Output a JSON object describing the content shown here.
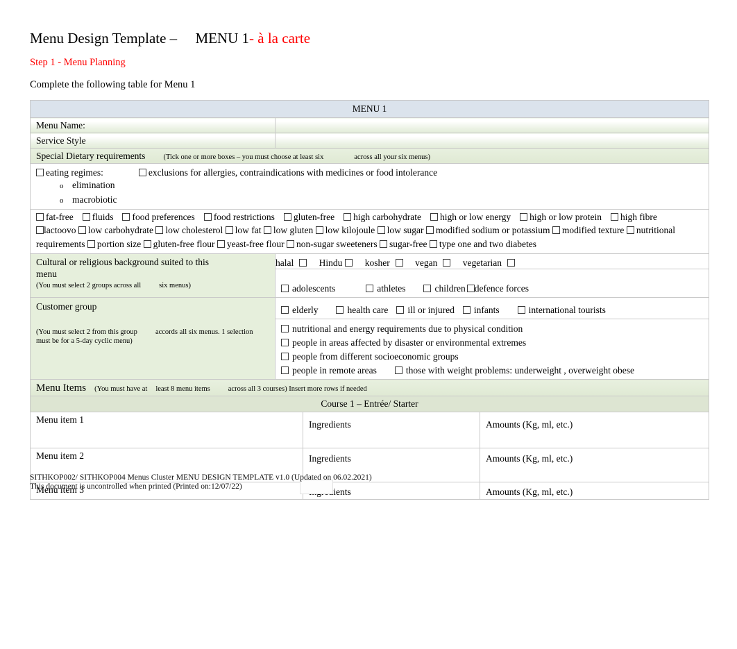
{
  "header": {
    "title_main": "Menu Design Template –",
    "title_menu": "MENU 1",
    "title_suffix": "- à la carte",
    "step": "Step 1 - Menu Planning",
    "instruction": "Complete the following table for Menu 1"
  },
  "table": {
    "menu_header": "MENU 1",
    "menu_name_label": "Menu Name:",
    "service_style_label": "Service Style",
    "special_dietary_label": "Special Dietary requirements",
    "special_dietary_note_a": "(Tick one or more boxes – you must choose at least six",
    "special_dietary_note_b": "across all your six menus)",
    "eating_regimes_label": "eating regimes:",
    "exclusions_label": "exclusions for allergies, contraindications with medicines or food intolerance",
    "eating_regimes_sub": [
      "elimination",
      "macrobiotic"
    ],
    "dietary_row1": [
      "fat-free",
      "fluids",
      "food preferences",
      "food restrictions",
      "gluten-free",
      "high carbohydrate",
      "high or low energy",
      "high or low protein",
      "high fibre"
    ],
    "dietary_row2": [
      "lactoovo",
      "low carbohydrate",
      "low cholesterol",
      "low fat",
      "low gluten",
      "low kilojoule",
      "low sugar",
      "modified sodium or potassium",
      "modified texture",
      "nutritional requirements",
      "portion size",
      "gluten-free flour",
      "yeast-free flour",
      "non-sugar sweeteners",
      "sugar-free",
      "type one and two diabetes"
    ],
    "cultural_label_line1": "Cultural or religious background suited to this",
    "cultural_label_line2": "menu",
    "cultural_note_a": "(You must select 2 groups across all",
    "cultural_note_b": "six menus)",
    "religions": [
      "halal",
      "Hindu",
      "kosher",
      "vegan",
      "vegetarian"
    ],
    "customer_group_label": "Customer group",
    "customer_group_note_a": "(You must select 2 from this group",
    "customer_group_note_b": "accords all six menus. 1 selection",
    "customer_group_note_c": "must be for a 5-day cyclic menu)",
    "customer_groups_row1": [
      "adolescents",
      "athletes",
      "children",
      "defence forces"
    ],
    "customer_groups_row2": [
      "elderly",
      "health care",
      "ill or injured",
      "infants",
      "international tourists"
    ],
    "customer_groups_rest": [
      "nutritional and energy requirements due to physical condition",
      "people in areas affected by disaster or environmental extremes",
      "people from different socioeconomic groups"
    ],
    "customer_groups_last_row": [
      "people in remote areas",
      "those with weight problems: underweight , overweight obese"
    ],
    "menu_items_label": "Menu Items",
    "menu_items_note_a": "(You must have at",
    "menu_items_note_b": "least 8 menu items",
    "menu_items_note_c": "across all 3 courses) Insert more rows if needed",
    "course_header": "Course 1 – Entrée/ Starter",
    "menu_rows": [
      {
        "item": "Menu item 1",
        "ingredients": "Ingredients",
        "amounts": "Amounts (Kg, ml, etc.)"
      },
      {
        "item": "Menu item 2",
        "ingredients": "Ingredients",
        "amounts": "Amounts (Kg, ml, etc.)"
      },
      {
        "item": "Menu item 3",
        "ingredients": "Ingredients",
        "amounts": "Amounts (Kg, ml, etc.)"
      }
    ]
  },
  "footer": {
    "line1": "SITHKOP002/ SITHKOP004 Menus Cluster MENU DESIGN TEMPLATE v1.0 (Updated on 06.02.2021)",
    "line2": "This document is uncontrolled when printed (Printed on:12/07/22)"
  },
  "colors": {
    "accent_red": "#ff0000",
    "header_blue": "#dbe3ec",
    "shade_green": "#e6efdc",
    "course_band": "#dde5d2"
  }
}
